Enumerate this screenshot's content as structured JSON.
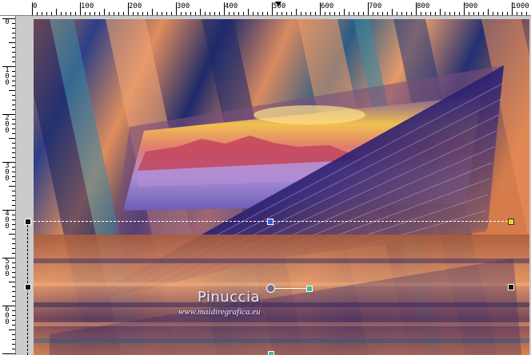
{
  "ruler_top": {
    "labels": [
      "0",
      "100",
      "200",
      "300",
      "400",
      "500",
      "600",
      "700",
      "800",
      "900",
      "1000"
    ]
  },
  "ruler_left": {
    "labels": [
      "0",
      "100",
      "200",
      "300",
      "400",
      "500",
      "600"
    ]
  },
  "watermark": {
    "name": "Pinuccia",
    "url": "www.maidiregrafica.eu"
  },
  "colors": {
    "ruler_bg": "#ffffff",
    "workspace_bg": "#cbcbcb",
    "orange": "#e0864a",
    "navy": "#1e2a6e",
    "purple": "#6a4aa8",
    "teal": "#2f7f8f",
    "gold": "#f3c25a"
  }
}
